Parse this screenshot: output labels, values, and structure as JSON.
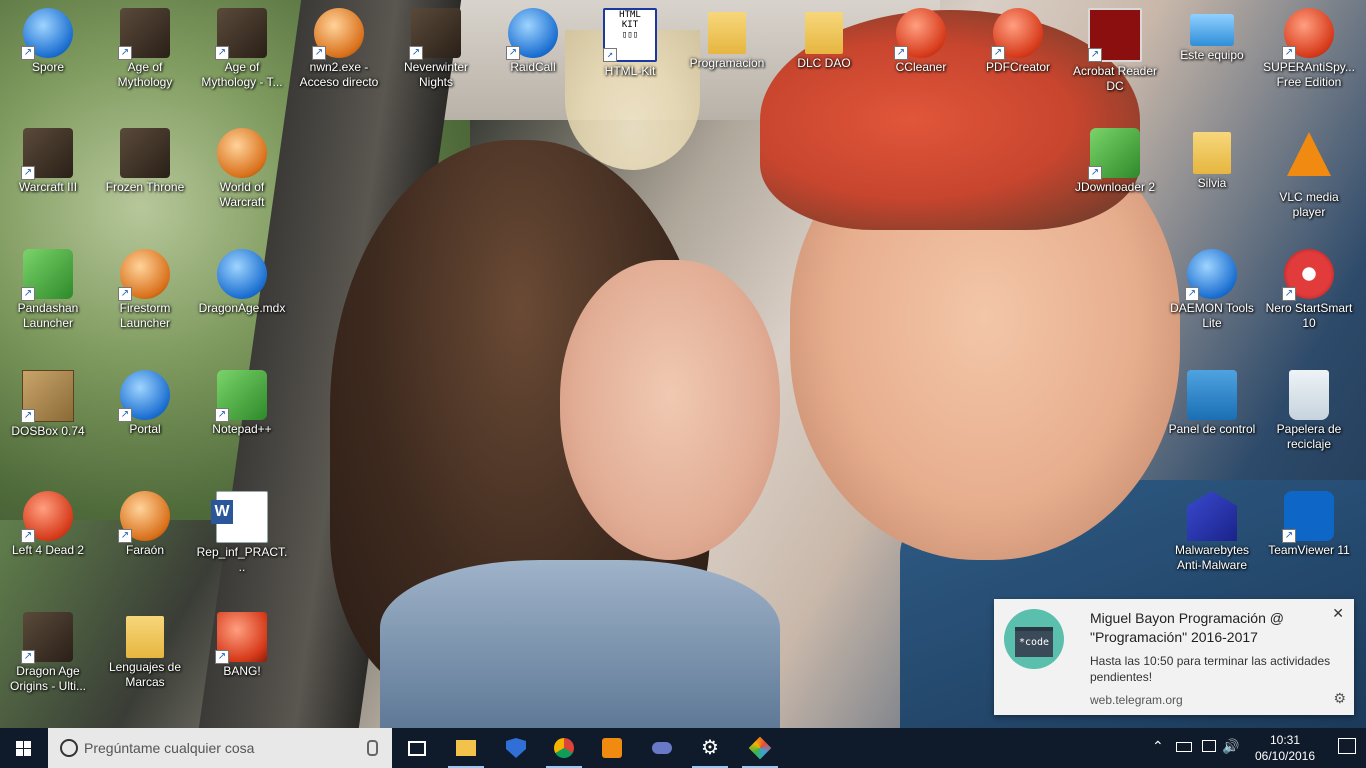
{
  "desktop": {
    "icons": [
      {
        "label": "Spore",
        "icon": "spore-icon"
      },
      {
        "label": "Age of Mythology",
        "icon": "age-of-mythology-icon"
      },
      {
        "label": "Age of Mythology - T...",
        "icon": "age-of-mythology-titans-icon"
      },
      {
        "label": "nwn2.exe - Acceso directo",
        "icon": "nwn2-icon"
      },
      {
        "label": "Neverwinter Nights",
        "icon": "neverwinter-nights-icon"
      },
      {
        "label": "RaidCall",
        "icon": "raidcall-icon"
      },
      {
        "label": "HTML-Kit",
        "icon": "html-kit-icon"
      },
      {
        "label": "Programacion",
        "icon": "folder-icon"
      },
      {
        "label": "DLC DAO",
        "icon": "folder-icon"
      },
      {
        "label": "CCleaner",
        "icon": "ccleaner-icon"
      },
      {
        "label": "PDFCreator",
        "icon": "pdfcreator-icon"
      },
      {
        "label": "Acrobat Reader DC",
        "icon": "acrobat-reader-icon"
      },
      {
        "label": "Este equipo",
        "icon": "this-pc-icon"
      },
      {
        "label": "SUPERAntiSpy... Free Edition",
        "icon": "superantispyware-icon"
      },
      {
        "label": "Warcraft III",
        "icon": "warcraft-iii-icon"
      },
      {
        "label": "Frozen Throne",
        "icon": "frozen-throne-icon"
      },
      {
        "label": "World of Warcraft",
        "icon": "world-of-warcraft-icon"
      },
      {
        "label": "JDownloader 2",
        "icon": "jdownloader-icon"
      },
      {
        "label": "Silvia",
        "icon": "folder-icon"
      },
      {
        "label": "VLC media player",
        "icon": "vlc-icon"
      },
      {
        "label": "Pandashan Launcher",
        "icon": "pandashan-icon"
      },
      {
        "label": "Firestorm Launcher",
        "icon": "firestorm-icon"
      },
      {
        "label": "DragonAge.mdx",
        "icon": "daemon-image-icon"
      },
      {
        "label": "DAEMON Tools Lite",
        "icon": "daemon-tools-icon"
      },
      {
        "label": "Nero StartSmart 10",
        "icon": "nero-icon"
      },
      {
        "label": "DOSBox 0.74",
        "icon": "dosbox-icon"
      },
      {
        "label": "Portal",
        "icon": "portal-icon"
      },
      {
        "label": "Notepad++",
        "icon": "notepad-plus-plus-icon"
      },
      {
        "label": "Panel de control",
        "icon": "control-panel-icon"
      },
      {
        "label": "Papelera de reciclaje",
        "icon": "recycle-bin-icon"
      },
      {
        "label": "Left 4 Dead 2",
        "icon": "left-4-dead-2-icon"
      },
      {
        "label": "Faraón",
        "icon": "faraon-icon"
      },
      {
        "label": "Rep_inf_PRACT...",
        "icon": "word-document-icon"
      },
      {
        "label": "Malwarebytes Anti-Malware",
        "icon": "malwarebytes-icon"
      },
      {
        "label": "TeamViewer 11",
        "icon": "teamviewer-icon"
      },
      {
        "label": "Dragon Age Origins - Ulti...",
        "icon": "dragon-age-origins-icon"
      },
      {
        "label": "Lenguajes de Marcas",
        "icon": "folder-icon"
      },
      {
        "label": "BANG!",
        "icon": "bang-icon"
      }
    ]
  },
  "taskbar": {
    "search_placeholder": "Pregúntame cualquier cosa",
    "pinned": [
      "task-view-icon",
      "file-explorer-icon",
      "windows-defender-icon",
      "chrome-icon",
      "media-player-icon",
      "gamepad-icon",
      "settings-icon",
      "gitkraken-icon"
    ],
    "time": "10:31",
    "date": "06/10/2016"
  },
  "toast": {
    "title": "Miguel Bayon Programación @ \"Programación\" 2016-2017",
    "body": "Hasta las 10:50 para terminar las actividades pendientes!",
    "source": "web.telegram.org",
    "app_icon_text": "*code",
    "close_glyph": "✕",
    "settings_glyph": "⚙"
  }
}
